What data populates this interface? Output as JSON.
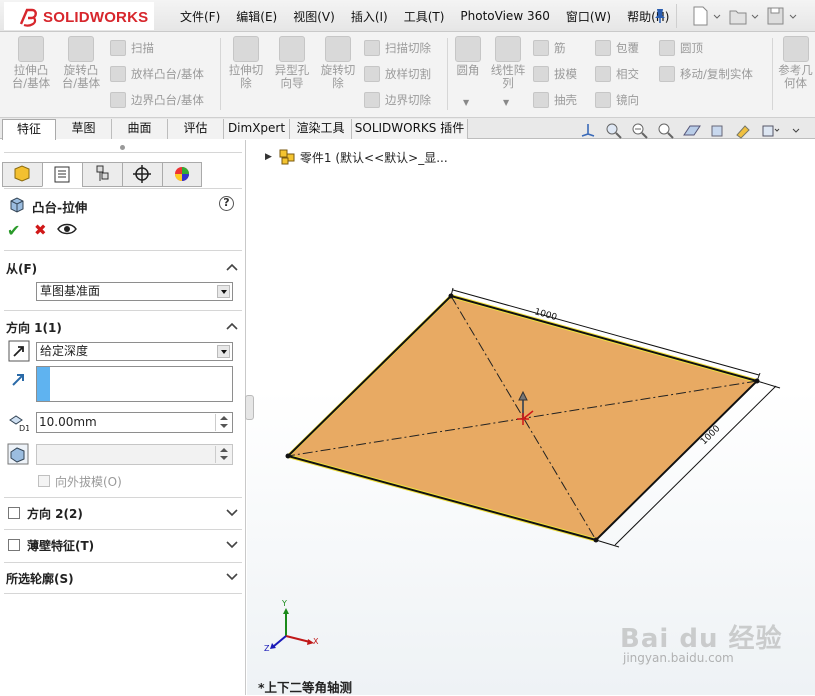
{
  "app": {
    "logo_text": "SOLIDWORKS",
    "accent_color": "#d7262c"
  },
  "menu": [
    "文件(F)",
    "编辑(E)",
    "视图(V)",
    "插入(I)",
    "工具(T)",
    "PhotoView 360",
    "窗口(W)",
    "帮助(H)"
  ],
  "command_manager": {
    "extrude_boss": "拉伸凸\n台/基体",
    "revolve_boss": "旋转凸\n台/基体",
    "sweep": "扫描",
    "loft": "放样凸台/基体",
    "boundary_boss": "边界凸台/基体",
    "extrude_cut": "拉伸切\n除",
    "hole_wizard": "异型孔\n向导",
    "revolve_cut": "旋转切\n除",
    "swept_cut": "扫描切除",
    "lofted_cut": "放样切割",
    "boundary_cut": "边界切除",
    "fillet": "圆角",
    "linear_pattern": "线性阵\n列",
    "rib": "筋",
    "draft": "拔模",
    "shell": "抽壳",
    "wrap": "包覆",
    "intersect": "相交",
    "mirror": "镜向",
    "dome": "圆顶",
    "move_copy": "移动/复制实体",
    "reference_geometry": "参考几\n何体"
  },
  "tabs": [
    "特征",
    "草图",
    "曲面",
    "评估",
    "DimXpert",
    "渲染工具",
    "SOLIDWORKS 插件"
  ],
  "feature_tree": {
    "item": "零件1  (默认<<默认>_显..."
  },
  "property_manager": {
    "title": "凸台-拉伸",
    "from_label": "从(F)",
    "from_value": "草图基准面",
    "direction1_label": "方向 1(1)",
    "end_condition": "给定深度",
    "depth_value": "10.00mm",
    "draft_outward": "向外拔模(O)",
    "direction2_label": "方向 2(2)",
    "thin_feature_label": "薄壁特征(T)",
    "selected_contours_label": "所选轮廓(S)"
  },
  "graphics": {
    "dim_top": "1000",
    "dim_right": "1000",
    "view_name": "*上下二等角轴测",
    "triad_x": "X",
    "triad_y": "Y",
    "triad_z": "Z",
    "face_color": "#e8aa63",
    "highlight_color": "#f0e040"
  },
  "watermark": {
    "main": "Bai du 经验",
    "sub": "jingyan.baidu.com"
  }
}
